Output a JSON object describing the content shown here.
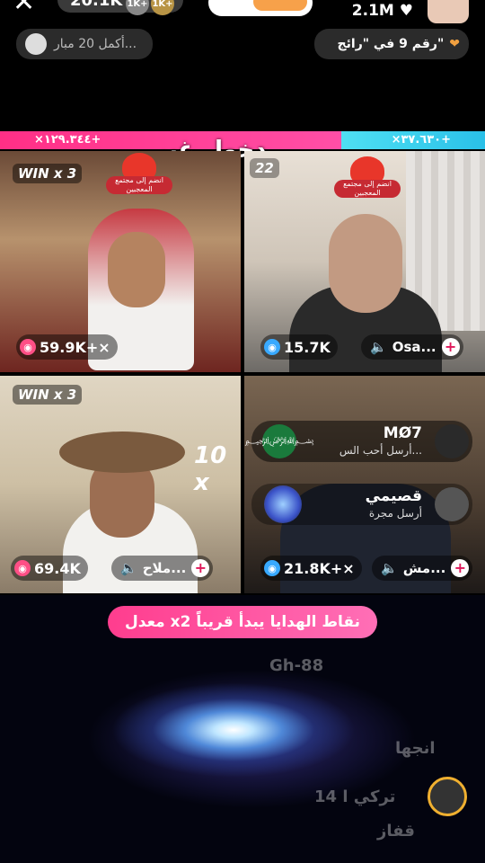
{
  "top": {
    "viewer_count": "20.1K",
    "badge_1": "1K+",
    "badge_2": "1K+",
    "likes": "2.1M",
    "likes_heart": "♥",
    "notice_left": "أكمل 20 مبار...",
    "notice_right": "رقم 9 في \"رائج\"",
    "close": "✕"
  },
  "score": {
    "left": "×۱۲۹.۳٤٤+",
    "right": "×۳۷.٦۳۰+",
    "entry_text": "دخول غير"
  },
  "countdown": "22",
  "tiles": [
    {
      "win": "WIN x 3",
      "count": "59.9K+×",
      "sticker": "انضم إلى مجتمع المعجبين"
    },
    {
      "count": "15.7K",
      "name": "Osa...",
      "sticker": "انضم إلى مجتمع المعجبين"
    },
    {
      "win": "WIN x 3",
      "count": "69.4K",
      "name": "ملاح...",
      "multiplier": "10 x"
    },
    {
      "count": "21.8K+×",
      "name": "مش..."
    }
  ],
  "chat": [
    {
      "name": "MØ7",
      "text": "أرسل أحب الس..."
    },
    {
      "name": "قصيمي",
      "text": "أرسل مجرة"
    }
  ],
  "gift_banner": "معدل x2 نقاط الهدايا يبدأ قريباً",
  "ghost_text": {
    "line1": "Gh-88",
    "line2": "انجها",
    "line3": "14 تركي ا",
    "line4": "قفاز"
  },
  "icons": [
    "close-icon",
    "heart-icon",
    "camera-icon",
    "mute-icon",
    "plus-icon",
    "saudi-flag-icon",
    "galaxy-icon"
  ],
  "colors": {
    "pink": "#ff2f86",
    "cyan": "#2ac0e8",
    "accent": "#e0185a"
  }
}
